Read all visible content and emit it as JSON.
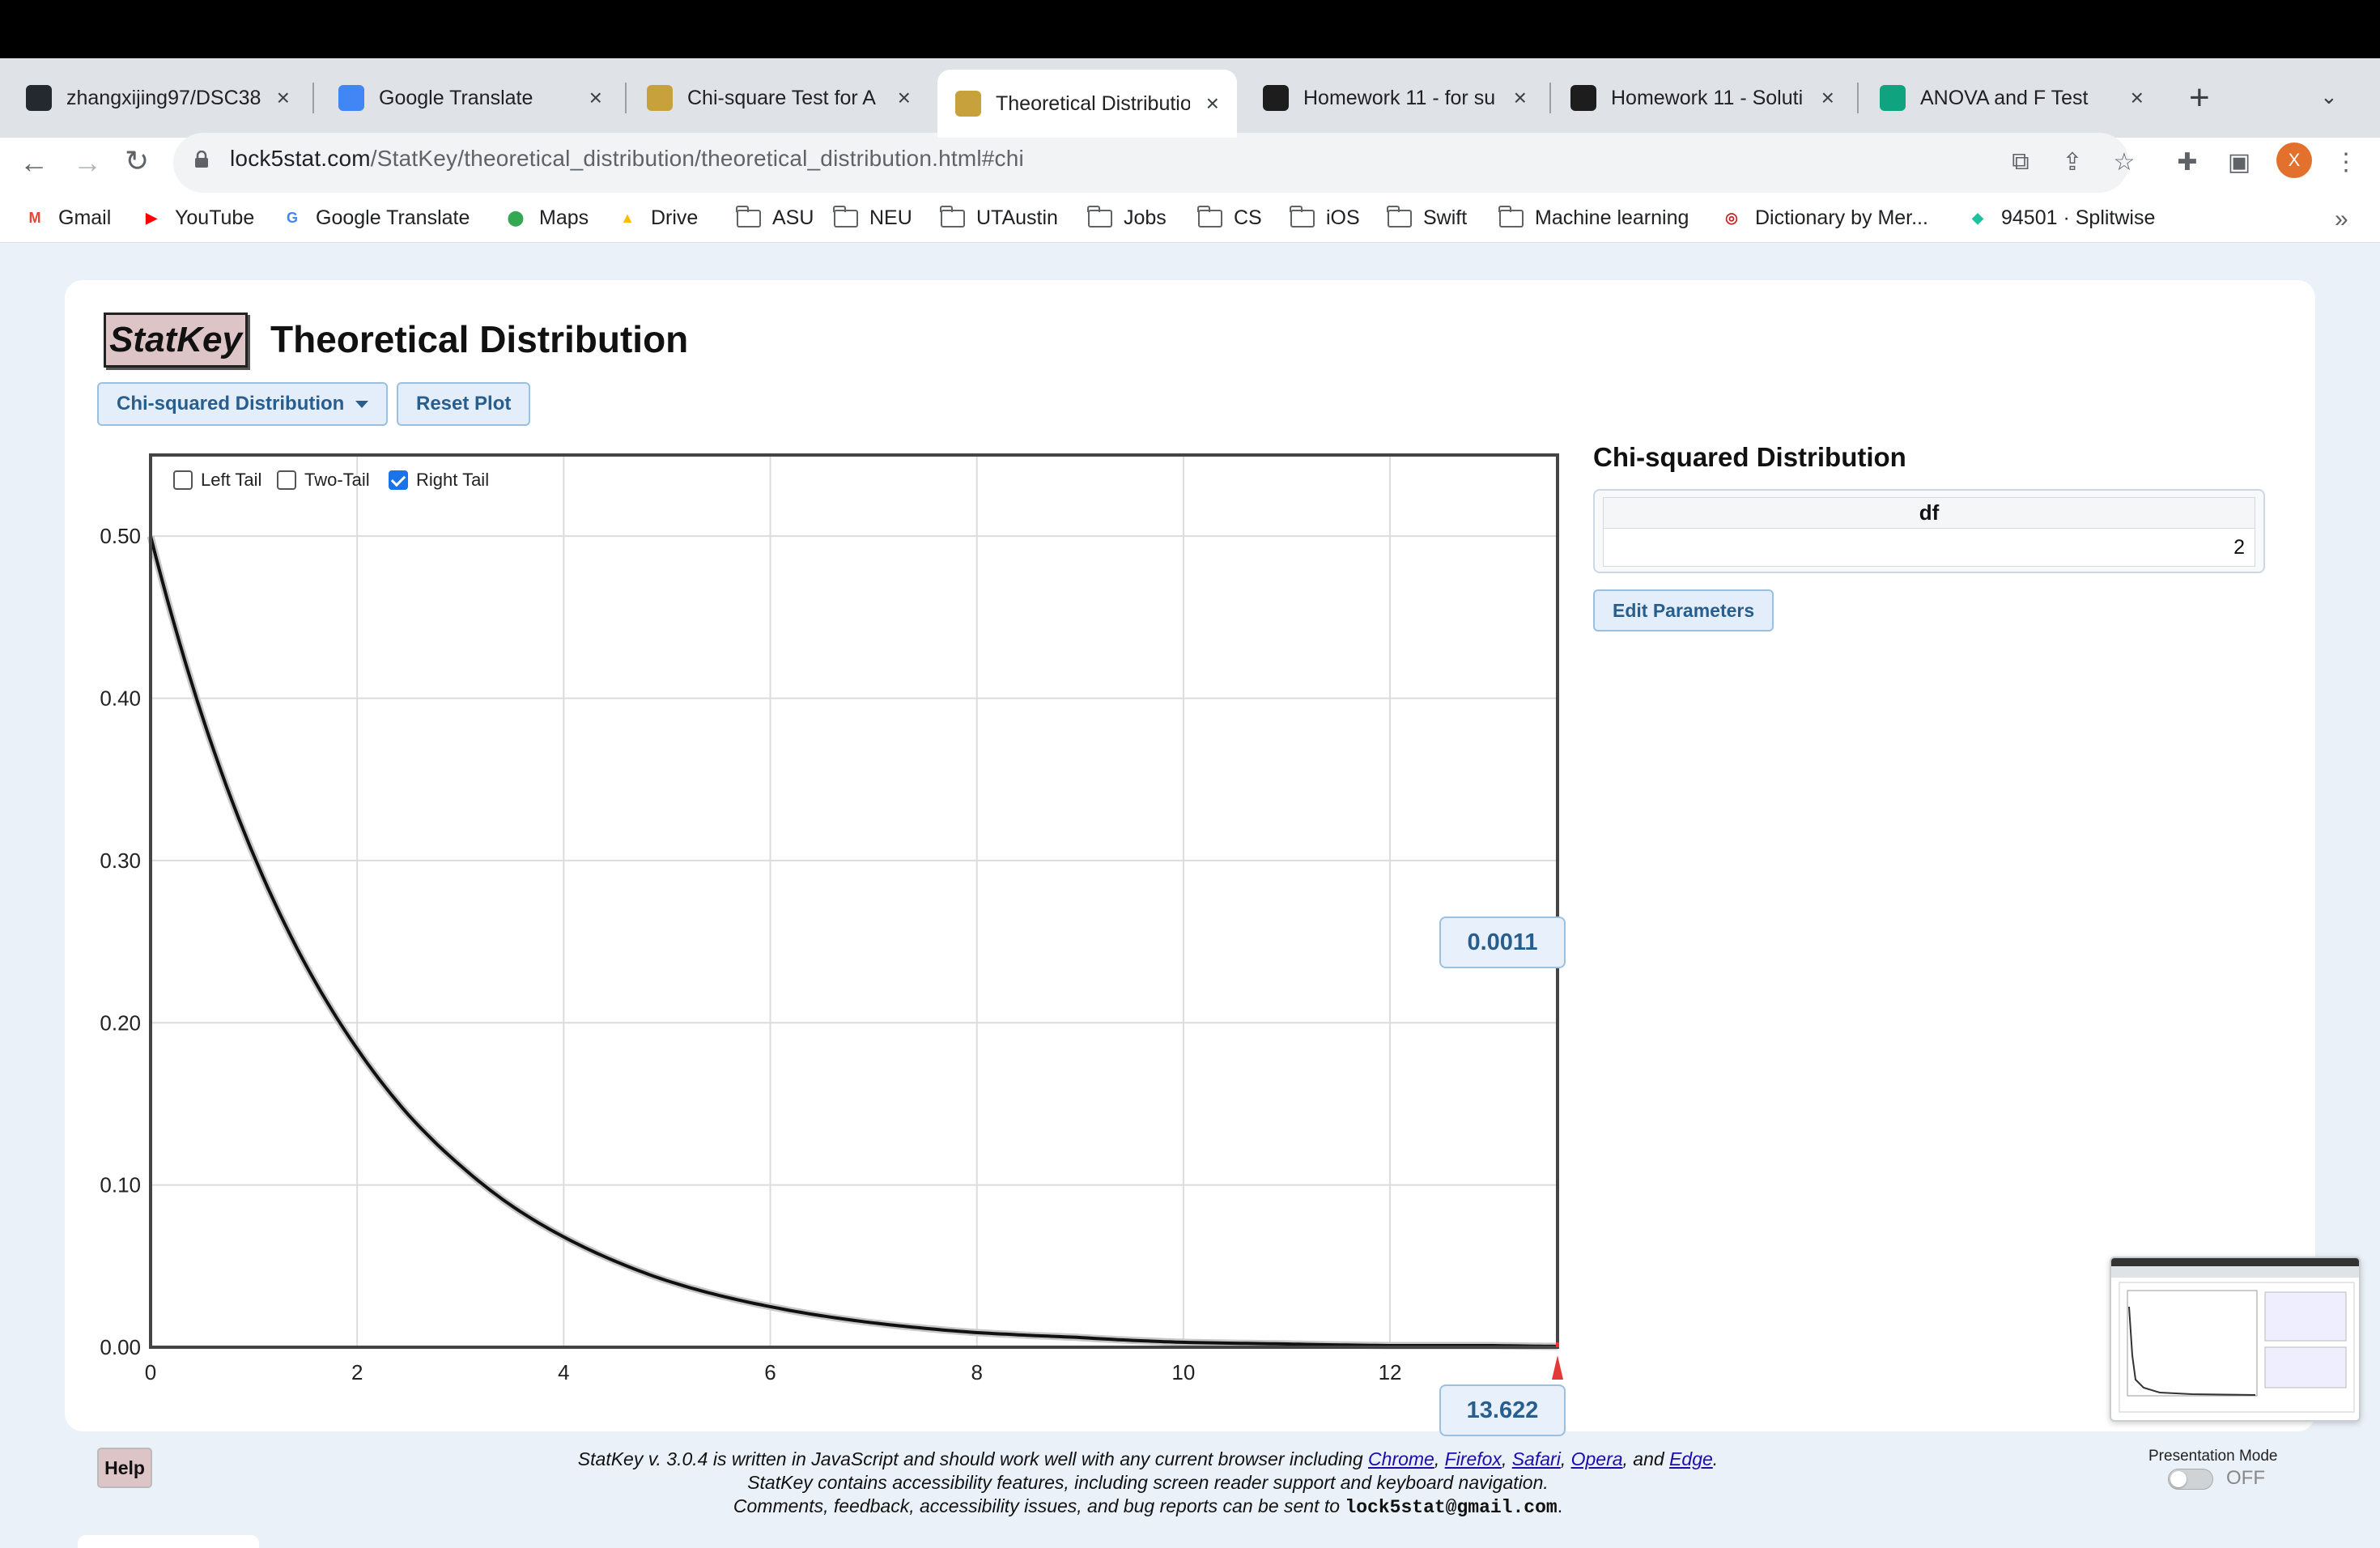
{
  "browser": {
    "tabs": [
      {
        "title": "zhangxijing97/DSC38",
        "icon": "github-icon",
        "color": "#24292f"
      },
      {
        "title": "Google Translate",
        "icon": "google-translate-icon",
        "color": "#4285f4"
      },
      {
        "title": "Chi-square Test for A",
        "icon": "lock5-icon",
        "color": "#c7a23c"
      },
      {
        "title": "Theoretical Distributio",
        "icon": "lock5-icon",
        "color": "#c7a23c",
        "active": true
      },
      {
        "title": "Homework 11 - for su",
        "icon": "edx-icon",
        "color": "#1d1d1d"
      },
      {
        "title": "Homework 11 - Soluti",
        "icon": "edx-icon",
        "color": "#1d1d1d"
      },
      {
        "title": "ANOVA and F Test",
        "icon": "chatgpt-icon",
        "color": "#10a37f"
      }
    ],
    "url_host": "lock5stat.com",
    "url_path": "/StatKey/theoretical_distribution/theoretical_distribution.html#chi",
    "avatar_letter": "X",
    "bookmarks": [
      {
        "label": "Gmail",
        "icon": "gmail-icon"
      },
      {
        "label": "YouTube",
        "icon": "youtube-icon"
      },
      {
        "label": "Google Translate",
        "icon": "google-translate-icon"
      },
      {
        "label": "Maps",
        "icon": "maps-icon"
      },
      {
        "label": "Drive",
        "icon": "drive-icon"
      },
      {
        "label": "ASU",
        "icon": "folder-icon"
      },
      {
        "label": "NEU",
        "icon": "folder-icon"
      },
      {
        "label": "UTAustin",
        "icon": "folder-icon"
      },
      {
        "label": "Jobs",
        "icon": "folder-icon"
      },
      {
        "label": "CS",
        "icon": "folder-icon"
      },
      {
        "label": "iOS",
        "icon": "folder-icon"
      },
      {
        "label": "Swift",
        "icon": "folder-icon"
      },
      {
        "label": "Machine learning",
        "icon": "folder-icon"
      },
      {
        "label": "Dictionary by Mer...",
        "icon": "merriam-webster-icon"
      },
      {
        "label": "94501 · Splitwise",
        "icon": "splitwise-icon"
      }
    ]
  },
  "app": {
    "logo": "StatKey",
    "title": "Theoretical Distribution",
    "dist_button": "Chi-squared Distribution",
    "reset_button": "Reset Plot",
    "tails": {
      "left": "Left Tail",
      "two": "Two-Tail",
      "right": "Right Tail",
      "checked": "right"
    },
    "right_tail_prob": "0.0011",
    "cutoff": "13.622",
    "panel": {
      "heading": "Chi-squared Distribution",
      "param_name": "df",
      "param_value": "2",
      "edit_button": "Edit Parameters"
    },
    "help": "Help",
    "footer": {
      "line1_pre": "StatKey v. 3.0.4 is written in JavaScript and should work well with any current browser including ",
      "browsers": [
        "Chrome",
        "Firefox",
        "Safari",
        "Opera",
        "Edge"
      ],
      "line2": "StatKey contains accessibility features, including screen reader support and keyboard navigation.",
      "line3_pre": "Comments, feedback, accessibility issues, and bug reports can be sent to ",
      "email": "lock5stat@gmail.com",
      "and": ", and "
    },
    "presentation_mode": {
      "label": "Presentation Mode",
      "state": "OFF"
    }
  },
  "chart_data": {
    "type": "line",
    "title": "",
    "xlabel": "",
    "ylabel": "",
    "xlim": [
      0,
      13.622
    ],
    "ylim": [
      0,
      0.55
    ],
    "xticks": [
      "0",
      "2",
      "4",
      "6",
      "8",
      "10",
      "12"
    ],
    "yticks": [
      "0.00",
      "0.10",
      "0.20",
      "0.30",
      "0.40",
      "0.50"
    ],
    "grid": true,
    "series": [
      {
        "x": [
          0,
          0.5,
          1,
          1.5,
          2,
          2.5,
          3,
          3.5,
          4,
          4.5,
          5,
          5.5,
          6,
          7,
          8,
          9,
          10,
          11,
          12,
          13,
          13.622
        ],
        "y": [
          0.5,
          0.389,
          0.303,
          0.236,
          0.184,
          0.143,
          0.112,
          0.087,
          0.068,
          0.053,
          0.041,
          0.032,
          0.025,
          0.015,
          0.009,
          0.006,
          0.003,
          0.002,
          0.001,
          0.001,
          0.0005
        ]
      }
    ],
    "cutoff_x": 13.622,
    "shaded_tail": "right",
    "tail_probability": 0.0011
  }
}
